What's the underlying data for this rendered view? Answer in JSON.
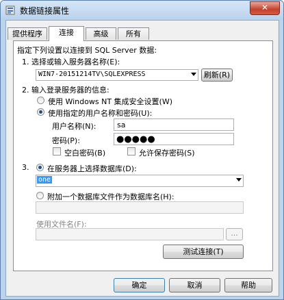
{
  "window": {
    "title": "数据链接属性",
    "close_label": "✕"
  },
  "tabs": [
    {
      "label": "提供程序",
      "active": false
    },
    {
      "label": "连接",
      "active": true
    },
    {
      "label": "高级",
      "active": false
    },
    {
      "label": "所有",
      "active": false
    }
  ],
  "intro": "指定下列设置以连接到 SQL Server 数据:",
  "step1": {
    "label": "1. 选择或输入服务器名称(E):",
    "server_value": "WIN7-20151214TV\\SQLEXPRESS",
    "refresh_label": "刷新(R)"
  },
  "step2": {
    "label": "2. 输入登录服务器的信息:",
    "windows_auth_label": "使用 Windows NT 集成安全设置(W)",
    "sql_auth_label": "使用指定的用户名称和密码(U):",
    "username_label": "用户名称(N):",
    "username_value": "sa",
    "password_label": "密码(P):",
    "password_value": "●●●●●",
    "blank_password_label": "空白密码(B)",
    "save_password_label": "允许保存密码(S)"
  },
  "step3": {
    "number": "3.",
    "select_db_label": "在服务器上选择数据库(D):",
    "db_value": "one",
    "attach_label": "附加一个数据库文件作为数据库名(H):",
    "use_filename_label": "使用文件名(F):",
    "browse_label": "..."
  },
  "test_button_label": "测试连接(T)",
  "footer": {
    "ok_label": "确定",
    "cancel_label": "取消",
    "help_label": "帮助"
  }
}
